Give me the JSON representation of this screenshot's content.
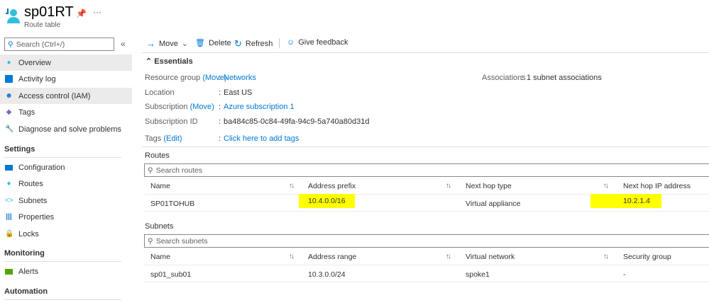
{
  "header": {
    "title": "sp01RT",
    "subtitle": "Route table"
  },
  "sidebar": {
    "search_placeholder": "Search (Ctrl+/)",
    "items": [
      {
        "label": "Overview"
      },
      {
        "label": "Activity log"
      },
      {
        "label": "Access control (IAM)"
      },
      {
        "label": "Tags"
      },
      {
        "label": "Diagnose and solve problems"
      }
    ],
    "sections": [
      {
        "title": "Settings",
        "items": [
          {
            "label": "Configuration"
          },
          {
            "label": "Routes"
          },
          {
            "label": "Subnets"
          },
          {
            "label": "Properties"
          },
          {
            "label": "Locks"
          }
        ]
      },
      {
        "title": "Monitoring",
        "items": [
          {
            "label": "Alerts"
          }
        ]
      },
      {
        "title": "Automation"
      }
    ]
  },
  "toolbar": {
    "move": "Move",
    "delete": "Delete",
    "refresh": "Refresh",
    "feedback": "Give feedback"
  },
  "essentials": {
    "title": "Essentials",
    "resource_group_label": "Resource group",
    "move_link": "(Move)",
    "resource_group": "Networks",
    "location_label": "Location",
    "location": "East US",
    "subscription_label": "Subscription",
    "subscription": "Azure subscription 1",
    "subscription_id_label": "Subscription ID",
    "subscription_id": "ba484c85-0c84-49fa-94c9-5a740a80d31d",
    "tags_label": "Tags",
    "edit_link": "(Edit)",
    "tags": "Click here to add tags",
    "associations_label": "Associations",
    "associations": "1 subnet associations",
    "sep": ":"
  },
  "routes": {
    "title": "Routes",
    "search_placeholder": "Search routes",
    "columns": [
      "Name",
      "Address prefix",
      "Next hop type",
      "Next hop IP address"
    ],
    "rows": [
      [
        "SP01TOHUB",
        "10.4.0.0/16",
        "Virtual appliance",
        "10.2.1.4"
      ]
    ]
  },
  "subnets": {
    "title": "Subnets",
    "search_placeholder": "Search subnets",
    "columns": [
      "Name",
      "Address range",
      "Virtual network",
      "Security group"
    ],
    "rows": [
      [
        "sp01_sub01",
        "10.3.0.0/24",
        "spoke1",
        "-"
      ]
    ]
  },
  "colors": {
    "accent": "#0078d4",
    "highlight": "#ffff00"
  }
}
